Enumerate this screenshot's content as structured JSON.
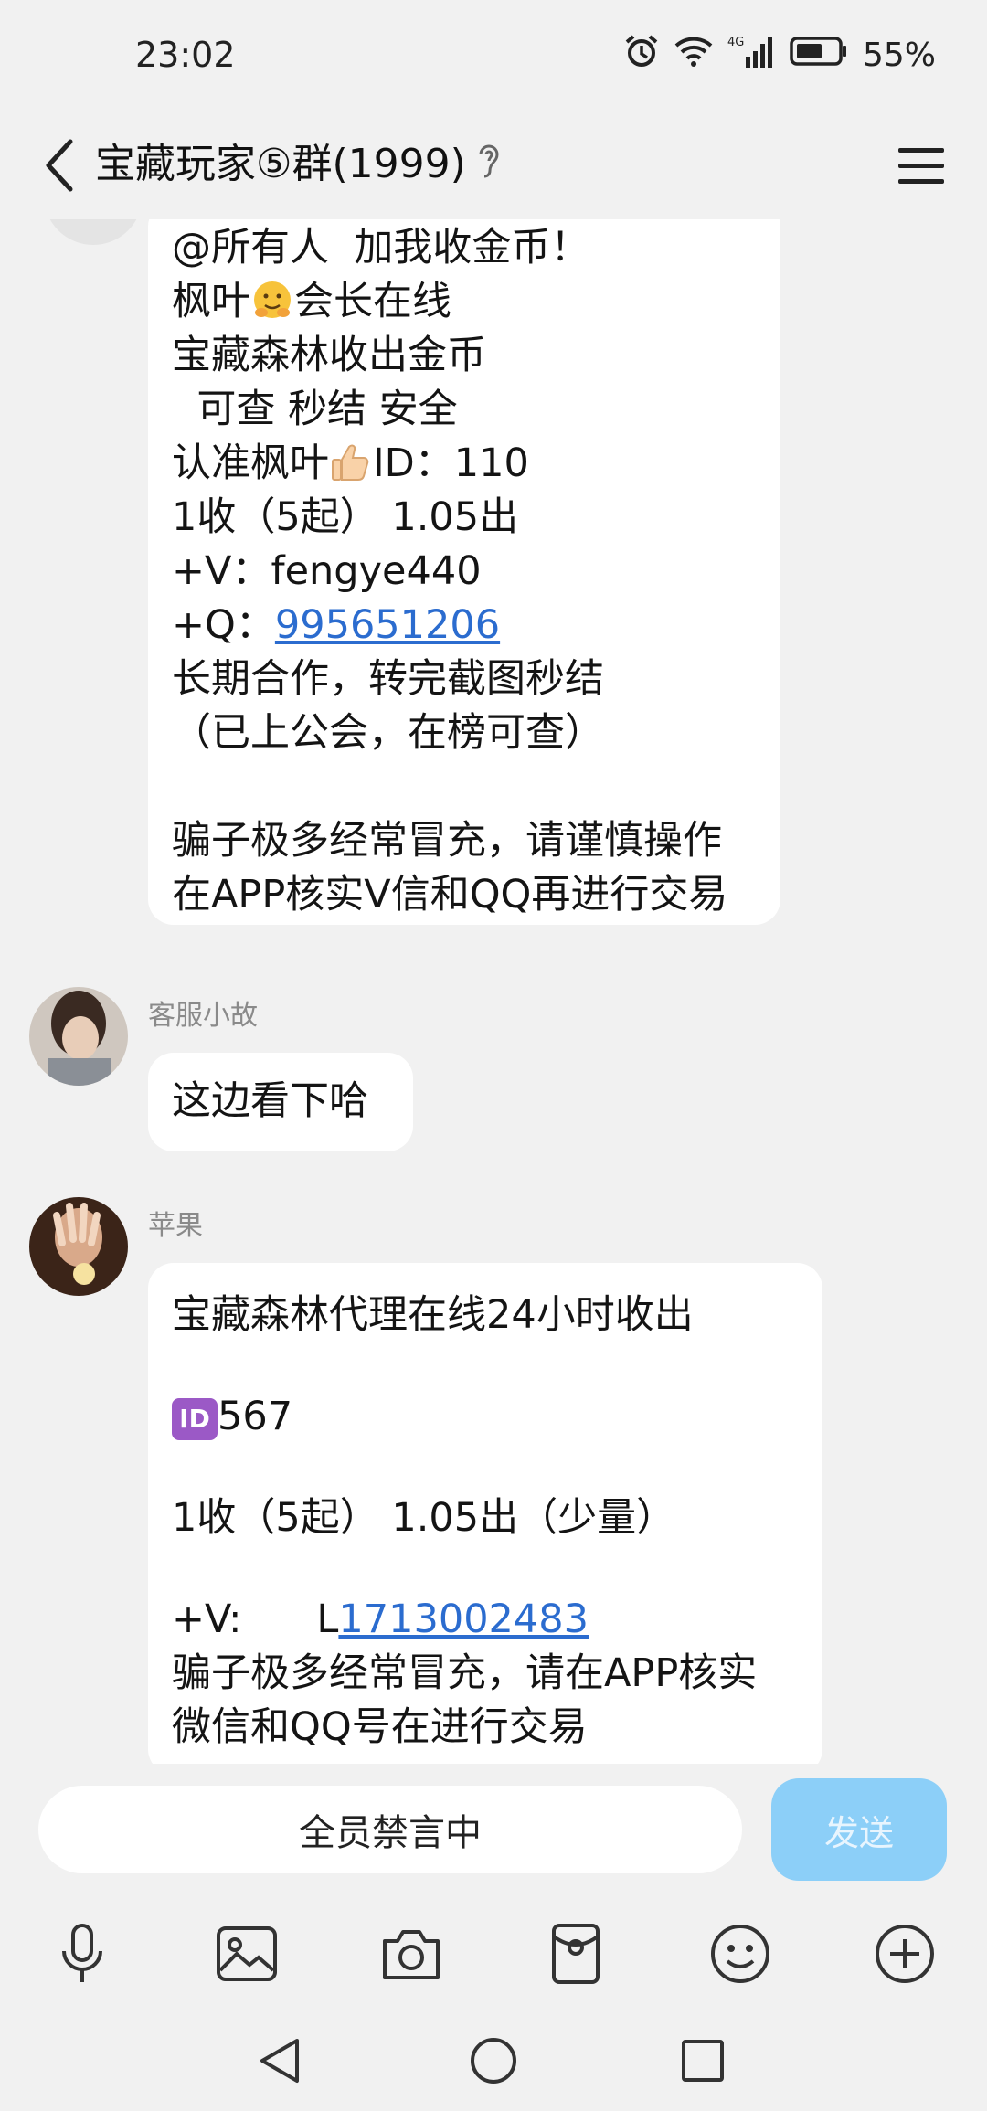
{
  "status_bar": {
    "time": "23:02",
    "battery": "55%",
    "network": "4G"
  },
  "header": {
    "title": "宝藏玩家⑤群(1999)"
  },
  "messages": [
    {
      "sender": "",
      "lines": [
        "@所有人  加我收金币！",
        "枫叶",
        "会长在线",
        "宝藏森林收出金币",
        "  可查 秒结 安全",
        "认准枫叶",
        "ID：110",
        "1收（5起） 1.05出",
        "+V：fengye440",
        "+Q：",
        "995651206",
        "长期合作，转完截图秒结",
        "（已上公会，在榜可查）",
        "骗子极多经常冒充，请谨慎操作",
        "在APP核实V信和QQ再进行交易"
      ]
    },
    {
      "sender": "客服小故",
      "lines": [
        "这边看下哈"
      ]
    },
    {
      "sender": "苹果",
      "lines": [
        "宝藏森林代理在线24小时收出",
        "ID",
        "567",
        "1收（5起） 1.05出（少量）",
        "+V:      L",
        "1713002483",
        "骗子极多经常冒充，请在APP核实",
        "微信和QQ号在进行交易"
      ]
    }
  ],
  "input": {
    "placeholder": "全员禁言中",
    "send_label": "发送"
  },
  "toolbar": [
    "microphone-icon",
    "image-icon",
    "camera-icon",
    "red-packet-icon",
    "emoji-icon",
    "plus-icon"
  ],
  "colors": {
    "background": "#f1f1f1",
    "bubble": "#ffffff",
    "link": "#2b6ccf",
    "send_button": "#8ccff8"
  }
}
